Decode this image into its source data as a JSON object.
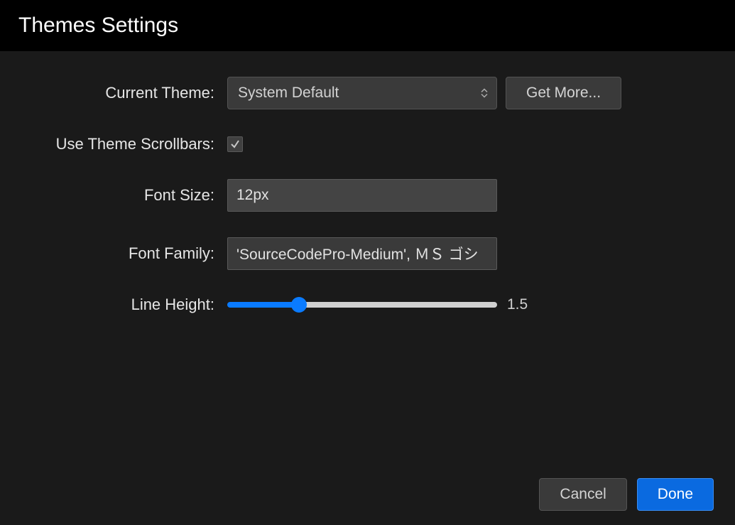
{
  "title": "Themes Settings",
  "form": {
    "currentTheme": {
      "label": "Current Theme:",
      "value": "System Default",
      "getMoreLabel": "Get More..."
    },
    "useThemeScrollbars": {
      "label": "Use Theme Scrollbars:",
      "checked": true
    },
    "fontSize": {
      "label": "Font Size:",
      "value": "12px"
    },
    "fontFamily": {
      "label": "Font Family:",
      "value": "'SourceCodePro-Medium', ＭＳ ゴシ"
    },
    "lineHeight": {
      "label": "Line Height:",
      "value": "1.5",
      "sliderPercent": 27
    }
  },
  "buttons": {
    "cancel": "Cancel",
    "done": "Done"
  }
}
